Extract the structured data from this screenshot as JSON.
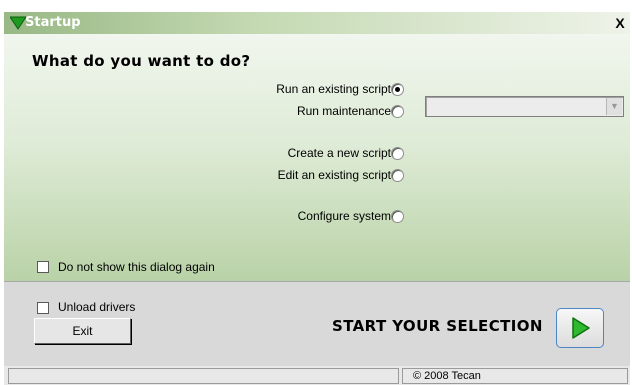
{
  "window": {
    "title": "Startup",
    "close_label": "X"
  },
  "dialog": {
    "question": "What do you want to do?",
    "options": [
      {
        "label": "Run an existing script",
        "checked": true
      },
      {
        "label": "Run maintenance",
        "checked": false
      },
      {
        "label": "Create a new script",
        "checked": false
      },
      {
        "label": "Edit an existing script",
        "checked": false
      },
      {
        "label": "Configure system",
        "checked": false
      }
    ],
    "maintenance_select": {
      "value": "",
      "enabled": false
    },
    "dont_show_label": "Do not show this dialog again"
  },
  "footer": {
    "unload_drivers_label": "Unload drivers",
    "exit_label": "Exit",
    "start_label": "START YOUR SELECTION"
  },
  "status": {
    "left": "",
    "copyright": "© 2008 Tecan"
  },
  "colors": {
    "accent_green": "#1f9a21",
    "titlebar_start": "#98b885",
    "start_button_border": "#4c87c4"
  },
  "icons": {
    "title": "green-triangle-icon",
    "start": "play-arrow-icon"
  }
}
